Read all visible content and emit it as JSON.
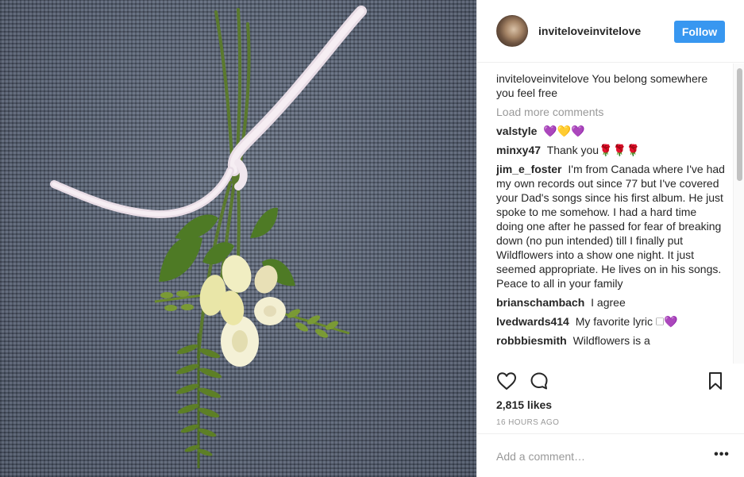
{
  "post": {
    "username": "inviteloveinvitelove",
    "follow_label": "Follow",
    "caption": {
      "user": "inviteloveinvitelove",
      "text": "You belong somewhere you feel free"
    },
    "load_more_label": "Load more comments",
    "comments": [
      {
        "user": "valstyle",
        "text": "💜💛💜"
      },
      {
        "user": "minxy47",
        "text": "Thank you🌹🌹🌹"
      },
      {
        "user": "jim_e_foster",
        "text": "I'm from Canada where I've had my own records out since 77 but I've covered your Dad's songs since his first album. He just spoke to me somehow. I had a hard time doing one after he passed for fear of breaking down (no pun intended) till I finally put Wildflowers into a show one night. It just seemed appropriate. He lives on in his songs. Peace to all in your family"
      },
      {
        "user": "brianschambach",
        "text": "I agree"
      },
      {
        "user": "lvedwards414",
        "text": "My favorite lyric 🗆💜"
      },
      {
        "user": "robbbiesmith",
        "text": "Wildflowers is a"
      }
    ],
    "likes_label": "2,815 likes",
    "timestamp": "16 HOURS AGO",
    "comment_placeholder": "Add a comment…",
    "more_label": "•••"
  },
  "icons": {
    "like": "heart-icon",
    "comment": "comment-bubble-icon",
    "save": "bookmark-icon",
    "more": "more-options-icon"
  },
  "colors": {
    "follow_button": "#3897f0",
    "muted_text": "#999999",
    "border": "#efefef"
  }
}
